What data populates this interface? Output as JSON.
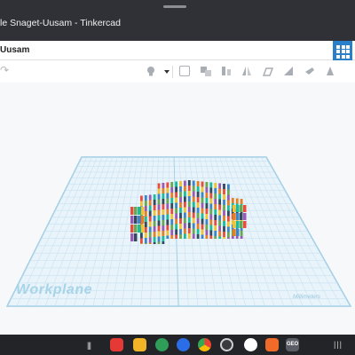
{
  "window": {
    "title": "le Snaget-Uusam - Tinkercad"
  },
  "header": {
    "design_name": "Uusam"
  },
  "toolbar": {
    "redo_glyph": "↷",
    "icons": [
      "lightbulb-icon",
      "group-icon",
      "ungroup-icon",
      "align-icon",
      "flip-icon",
      "workplane-tool-icon",
      "ruler-icon",
      "notes-icon",
      "export-icon",
      "share-icon"
    ]
  },
  "workplane": {
    "label": "Workplane",
    "units_label": "Millimeters"
  },
  "taskbar": {
    "recent_glyph": "|||",
    "menu_glyph": "|||",
    "apps": [
      "flipboard-icon",
      "files-icon",
      "phone-icon",
      "messages-icon",
      "chrome-icon",
      "camera-icon",
      "google-icon",
      "ludo-icon",
      "geo-icon"
    ],
    "geo_label": "GEO"
  },
  "colors": {
    "accent": "#2a7fc9",
    "grid": "#a8d4ea",
    "titlebar": "#2f3136",
    "taskbar": "#232427"
  }
}
